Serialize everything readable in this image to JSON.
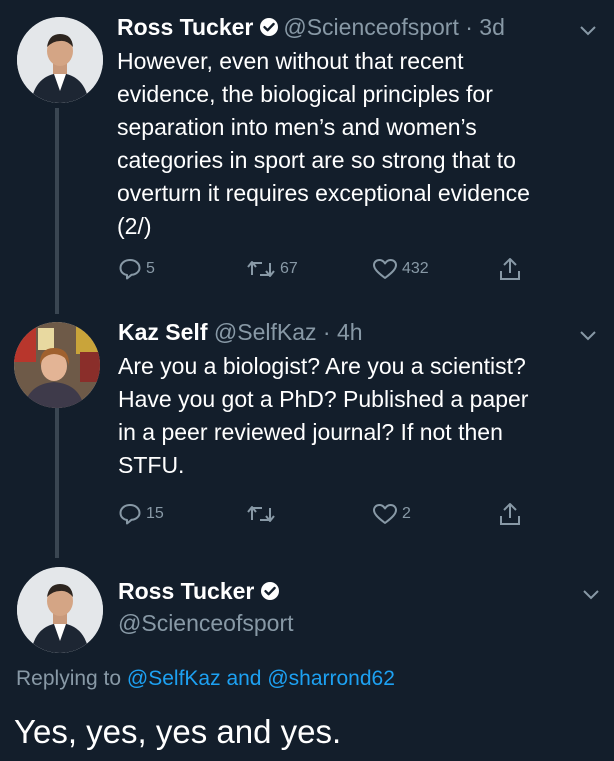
{
  "tweet1": {
    "name": "Ross Tucker",
    "handle": "@Scienceofsport",
    "time": "· 3d",
    "lines": [
      "However, even without that recent",
      "evidence, the biological principles for",
      "separation into men’s and women’s",
      "categories in sport are so strong that to",
      "overturn it requires exceptional evidence",
      "(2/)"
    ],
    "replies": "5",
    "retweets": "67",
    "likes": "432"
  },
  "tweet2": {
    "name": "Kaz Self",
    "handle": "@SelfKaz",
    "time": "· 4h",
    "lines": [
      "Are you a biologist? Are you a scientist?",
      "Have you got a PhD? Published a paper",
      "in a peer reviewed journal? If not then",
      "STFU."
    ],
    "replies": "15",
    "retweets": "",
    "likes": "2"
  },
  "tweet3": {
    "name": "Ross Tucker",
    "handle": "@Scienceofsport",
    "replying_prefix": "Replying to",
    "mention1": "@SelfKaz",
    "and": "and",
    "mention2": "@sharrond62",
    "text": "Yes, yes, yes and yes."
  },
  "colors": {
    "background": "#131e2b",
    "secondary_text": "#8899a6",
    "link": "#1da1f2"
  },
  "icons": [
    "verified-badge-icon",
    "chevron-down-icon",
    "reply-icon",
    "retweet-icon",
    "like-icon",
    "share-icon"
  ]
}
